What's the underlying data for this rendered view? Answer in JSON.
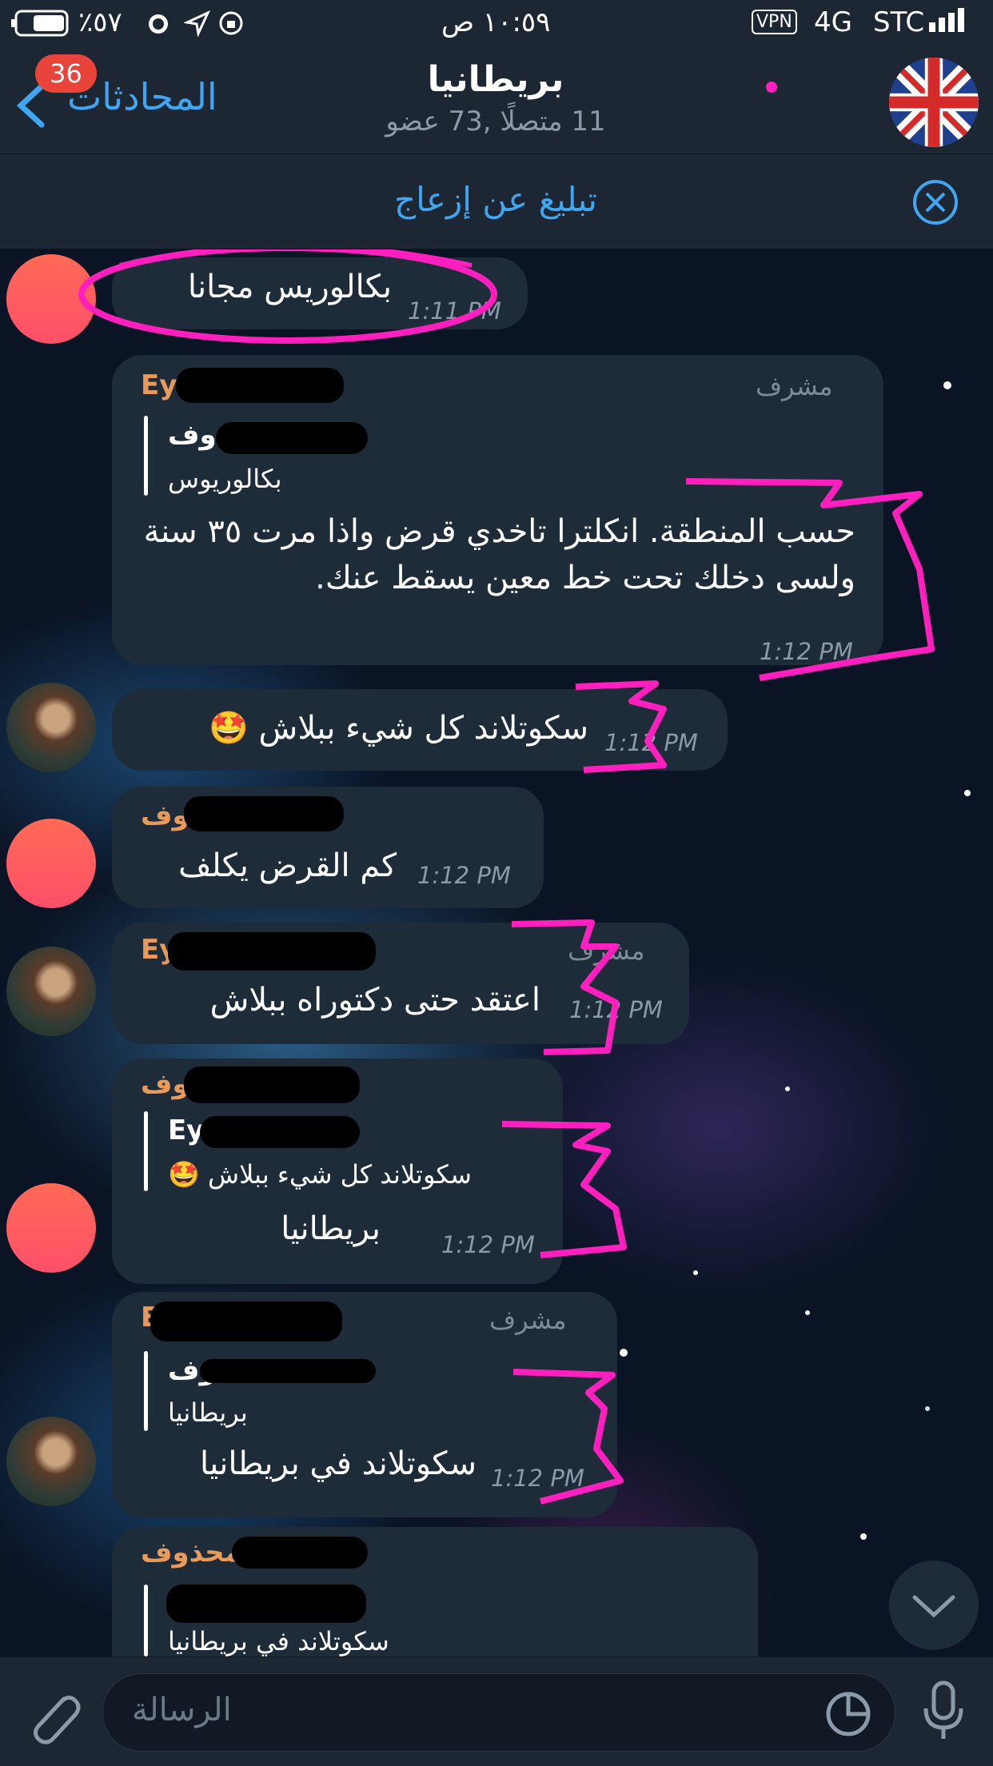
{
  "status_bar": {
    "carrier": "STC",
    "network": "4G",
    "vpn": "VPN",
    "time": "١٠:٥٩ ص",
    "battery": "٪٥٧"
  },
  "header": {
    "back_label": "المحادثات",
    "unread_badge": "36",
    "title": "بريطانيا",
    "subtitle": "11 متصلًا ,73 عضو"
  },
  "pinned": {
    "report_label": "تبليغ عن إزعاج"
  },
  "messages": [
    {
      "text": "بكالوريس مجانا",
      "time": "1:11 PM"
    },
    {
      "sender": "Ey",
      "admin": "مشرف",
      "quote_name": "ذوف",
      "quote_text": "بكالوريوس",
      "text": "حسب المنطقة. انكلترا تاخدي قرض واذا مرت ٣٥ سنة ولسى دخلك تحت خط معين يسقط عنك.",
      "time": "1:12 PM"
    },
    {
      "text": "سكوتلاند كل شيء ببلاش 🤩",
      "time": "1:12 PM"
    },
    {
      "sender": "حذوف",
      "text": "كم القرض يكلف",
      "time": "1:12 PM"
    },
    {
      "sender": "Ey",
      "admin": "مشرف",
      "text": "اعتقد حتى دكتوراه ببلاش",
      "time": "1:12 PM"
    },
    {
      "sender": "ذوف",
      "quote_name": "Ey",
      "quote_text": "سكوتلاند كل شيء ببلاش 🤩",
      "text": "بريطانيا",
      "time": "1:12 PM"
    },
    {
      "sender": "Ey",
      "admin": "مشرف",
      "quote_name": "ذوف",
      "quote_text": "بريطانيا",
      "text": "سكوتلاند في بريطانيا",
      "time": "1:12 PM"
    },
    {
      "sender": "حسب محذوف",
      "quote_name": "Ey",
      "quote_text": "سكوتلاند في بريطانيا"
    }
  ],
  "input": {
    "placeholder": "الرسالة"
  },
  "colors": {
    "bar_bg": "#1d2733",
    "accent": "#3ea6f2",
    "bubble": "#1e2c3a",
    "sender_name": "#e89a5a",
    "annotation": "#ff1fbf"
  }
}
